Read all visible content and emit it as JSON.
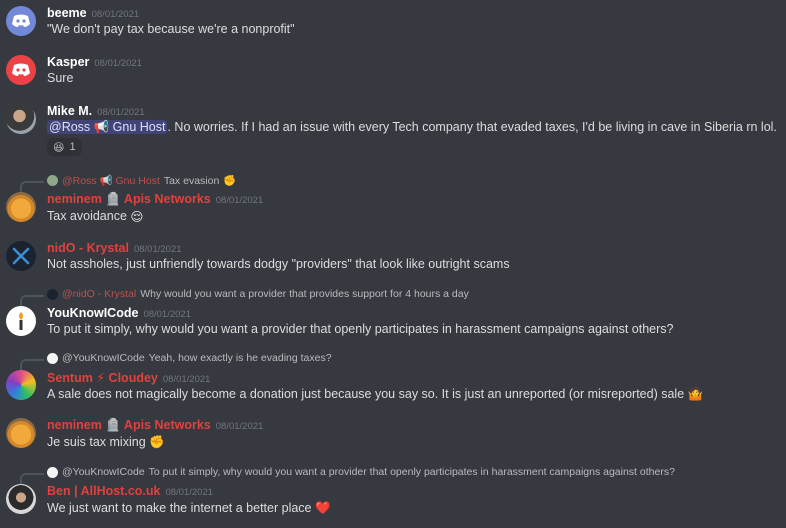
{
  "colors": {
    "discord_blurple": "#7289da",
    "discord_red": "#ed4245",
    "role_red": "#e2413e",
    "bg": "#36393f"
  },
  "messages": [
    {
      "author": "beeme",
      "timestamp": "08/01/2021",
      "text": "\"We don't pay tax because we're a nonprofit\""
    },
    {
      "author": "Kasper",
      "timestamp": "08/01/2021",
      "text": "Sure"
    },
    {
      "author": "Mike M.",
      "timestamp": "08/01/2021",
      "mention": "@Ross 📢 Gnu Host",
      "text": ". No worries. If I had an issue with every Tech company that evaded taxes, I'd be living in cave in Siberia rn lol.",
      "reaction": {
        "emoji": "😆",
        "count": "1"
      }
    },
    {
      "reply_to": "@Ross 📢 Gnu Host",
      "reply_text": "Tax evasion",
      "reply_emoji": "✊",
      "author": "neminem 🪦 Apis Networks",
      "timestamp": "08/01/2021",
      "text": "Tax avoidance",
      "emoji": "😌"
    },
    {
      "author": "nidO - Krystal",
      "timestamp": "08/01/2021",
      "text": "Not assholes, just unfriendly towards dodgy \"providers\" that look like outright scams"
    },
    {
      "reply_to": "@nidO - Krystal",
      "reply_text": "Why would you want a provider that provides support for 4 hours a day",
      "author": "YouKnowICode",
      "timestamp": "08/01/2021",
      "text": "To put it simply, why would you want a provider that openly participates in harassment campaigns against others?"
    },
    {
      "reply_to": "@YouKnowICode",
      "reply_text": "Yeah, how exactly is he evading taxes?",
      "author": "Sentum ⚡ Cloudey",
      "timestamp": "08/01/2021",
      "text": "A sale does not magically become a donation just because you say so. It is just an unreported (or misreported) sale",
      "emoji": "🤷"
    },
    {
      "author": "neminem 🪦 Apis Networks",
      "timestamp": "08/01/2021",
      "text": "Je suis tax mixing",
      "emoji": "✊"
    },
    {
      "reply_to": "@YouKnowICode",
      "reply_text": "To put it simply, why would you want a provider that openly participates in harassment campaigns against others?",
      "author": "Ben | AllHost.co.uk",
      "timestamp": "08/01/2021",
      "text": "We just want to make the internet a better place",
      "emoji": "❤️"
    }
  ]
}
